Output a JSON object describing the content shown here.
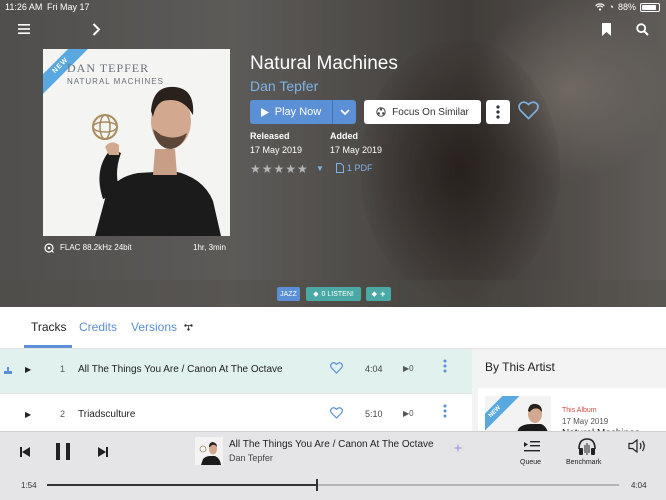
{
  "status_bar": {
    "time": "11:26 AM",
    "date": "Fri May 17",
    "battery": "88%",
    "battery_level": 0.88
  },
  "album": {
    "title": "Natural Machines",
    "artist": "Dan Tepfer",
    "cover_ribbon": "NEW",
    "cover_artist": "DAN TEPFER",
    "cover_title": "NATURAL MACHINES",
    "format": "FLAC 88.2kHz 24bit",
    "duration": "1hr, 3min",
    "released_label": "Released",
    "released_value": "17 May 2019",
    "added_label": "Added",
    "added_value": "17 May 2019",
    "rating_stars": "★★★★★",
    "rating_value": 0,
    "rating_max": 5,
    "pdf_label": "1 PDF"
  },
  "actions": {
    "play_now": "Play Now",
    "focus_similar": "Focus On Similar"
  },
  "tags": [
    {
      "label": "JAZZ",
      "color": "#5b8fd6"
    },
    {
      "label": "0 LISTEN!",
      "color": "#4aa9a4"
    },
    {
      "label": "+",
      "color": "#4aa9a4"
    }
  ],
  "tabs": [
    {
      "label": "Tracks",
      "active": true
    },
    {
      "label": "Credits",
      "active": false
    },
    {
      "label": "Versions",
      "active": false
    }
  ],
  "tracks": [
    {
      "number": "1",
      "title": "All The Things You Are / Canon At The Octave",
      "duration": "4:04",
      "plays": "0",
      "playing": true
    },
    {
      "number": "2",
      "title": "Triadsculture",
      "duration": "5:10",
      "plays": "0",
      "playing": false
    }
  ],
  "sidebar": {
    "title": "By This Artist",
    "ribbon": "NEW",
    "album_label": "This Album",
    "album_date": "17 May 2019",
    "album_name": "Natural Machines"
  },
  "player": {
    "now_playing_title": "All The Things You Are / Canon At The Octave",
    "now_playing_artist": "Dan Tepfer",
    "queue_label": "Queue",
    "benchmark_label": "Benchmark",
    "elapsed": "1:54",
    "total": "4:04",
    "progress": 0.47
  },
  "colors": {
    "accent": "#5b8fd6",
    "teal": "#4aa9a4",
    "playing_row": "#e0f1ee",
    "artist_link": "#7fb3e6"
  },
  "icons": {
    "menu": "menu-icon",
    "forward": "chevron-right-icon",
    "bookmark": "bookmark-icon",
    "search": "search-icon",
    "heart": "heart-icon",
    "more": "more-vertical-icon",
    "play": "play-icon",
    "pause": "pause-icon",
    "previous": "skip-previous-icon",
    "next": "skip-next-icon",
    "volume": "volume-icon",
    "queue": "queue-icon",
    "benchmark": "benchmark-icon"
  }
}
